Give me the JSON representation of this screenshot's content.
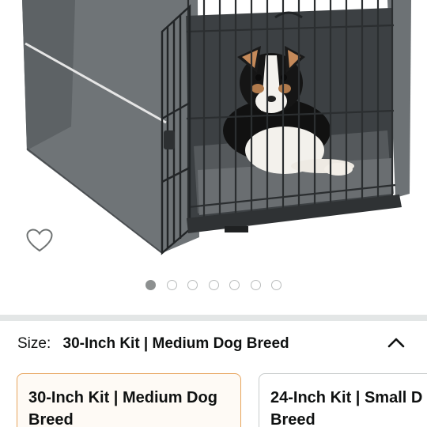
{
  "gallery": {
    "image_alt": "Dog crate with gray cover and a dog lying inside",
    "wishlist_icon": "heart-outline-icon",
    "dots_count": 7,
    "active_dot": 0
  },
  "variation": {
    "label": "Size:",
    "selected_value": "30-Inch Kit | Medium Dog Breed",
    "collapse_icon": "chevron-up-icon",
    "options": [
      {
        "line1": "30-Inch Kit | Medium Dog",
        "line2": "Breed",
        "selected": true
      },
      {
        "line1": "24-Inch Kit | Small D",
        "line2": "Breed",
        "selected": false
      }
    ]
  },
  "colors": {
    "selected_border": "#e7a45c",
    "selected_bg": "#fefaf5",
    "divider": "#e3e6e6",
    "active_dot": "#8d9090"
  }
}
